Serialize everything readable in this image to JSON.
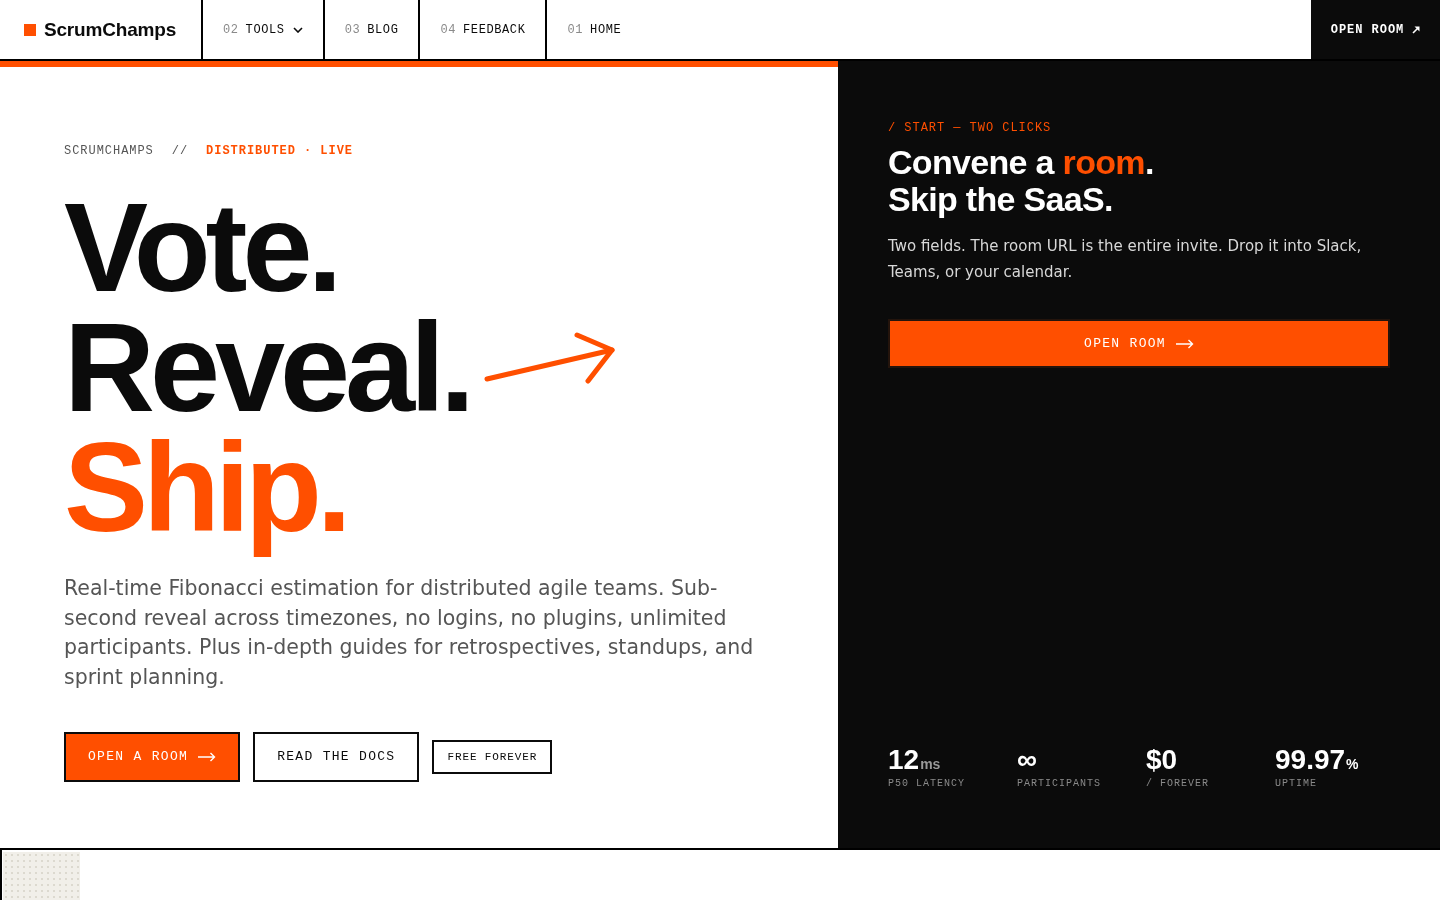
{
  "header": {
    "logo": {
      "text": "ScrumChamps"
    },
    "nav": [
      {
        "number": "02",
        "label": "TOOLS",
        "dropdown": true
      },
      {
        "number": "03",
        "label": "BLOG",
        "dropdown": false
      },
      {
        "number": "04",
        "label": "FEEDBACK",
        "dropdown": false
      },
      {
        "number": "01",
        "label": "HOME",
        "dropdown": false
      }
    ],
    "cta": {
      "label": "OPEN ROOM"
    }
  },
  "hero": {
    "eyebrow": {
      "brand": "SCRUMCHAMPS",
      "separator": "//",
      "tag": "DISTRIBUTED · LIVE"
    },
    "headline": [
      {
        "text": "Vote.",
        "accent": false,
        "arrow": false
      },
      {
        "text": "Reveal.",
        "accent": false,
        "arrow": true
      },
      {
        "text": "Ship.",
        "accent": true,
        "arrow": false
      }
    ],
    "description": "Real-time Fibonacci estimation for distributed agile teams. Sub-second reveal across timezones, no logins, no plugins, unlimited participants. Plus in-depth guides for retrospectives, standups, and sprint planning.",
    "actions": [
      {
        "label": "OPEN A ROOM",
        "kind": "primary"
      },
      {
        "label": "READ THE DOCS",
        "kind": "secondary"
      },
      {
        "label": "FREE FOREVER",
        "kind": "tag"
      }
    ]
  },
  "room_panel": {
    "eyebrow": "/ START — TWO CLICKS",
    "heading": {
      "lead": "Convene a ",
      "highlight": "room",
      "tail": ".",
      "line_2": "Skip the SaaS."
    },
    "description": "Two fields. The room URL is the entire invite. Drop it into Slack, Teams, or your calendar.",
    "button": {
      "label": "OPEN ROOM"
    },
    "stats": [
      {
        "value": "12",
        "unit": {
          "text": "ms",
          "muted": true
        },
        "label": "P50 LATENCY"
      },
      {
        "value": "∞",
        "label": "PARTICIPANTS"
      },
      {
        "value": "$0",
        "label": "/ FOREVER"
      },
      {
        "value": "99.97",
        "unit": {
          "text": "%",
          "muted": false
        },
        "label": "UPTIME"
      }
    ]
  }
}
